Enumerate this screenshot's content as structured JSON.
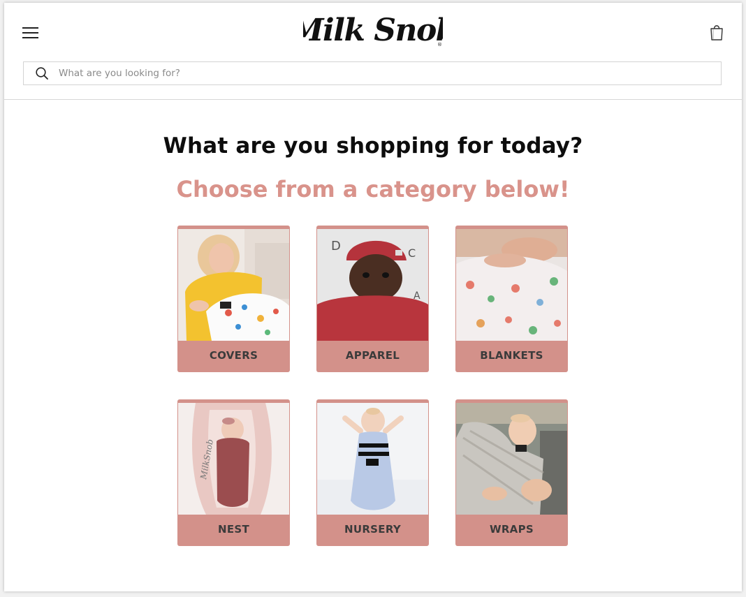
{
  "brand": {
    "logo_text": "Milk Snob"
  },
  "header": {
    "menu_icon": "hamburger-menu-icon",
    "cart_icon": "shopping-bag-icon"
  },
  "search": {
    "placeholder": "What are you looking for?",
    "value": "",
    "icon": "search-icon"
  },
  "main": {
    "title": "What are you shopping for today?",
    "subtitle": "Choose from a category below!"
  },
  "categories": [
    {
      "label": "COVERS"
    },
    {
      "label": "APPAREL"
    },
    {
      "label": "BLANKETS"
    },
    {
      "label": "NEST"
    },
    {
      "label": "NURSERY"
    },
    {
      "label": "WRAPS"
    }
  ],
  "colors": {
    "accent": "#d9938b",
    "card": "#d3918a",
    "label_text": "#3b3b3b",
    "title": "#0d0d0d"
  }
}
